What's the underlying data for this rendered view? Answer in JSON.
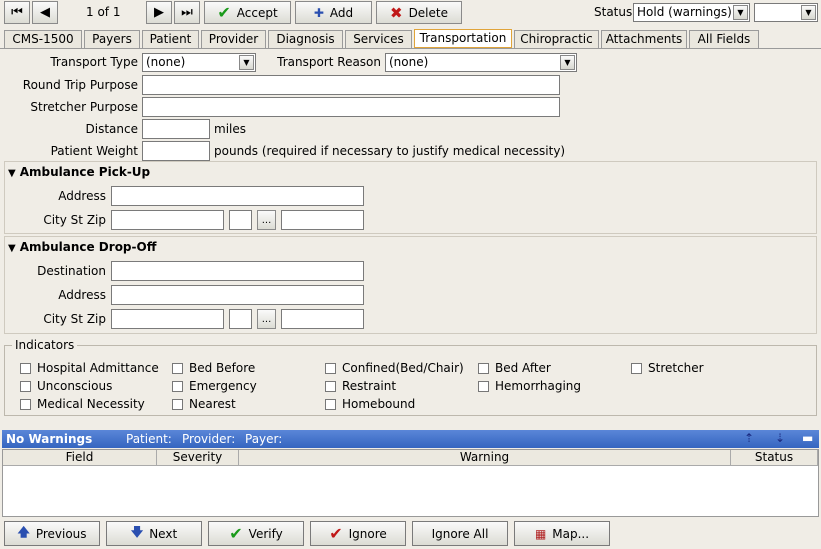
{
  "toolbar": {
    "record_position": "1 of 1",
    "accept_label": "Accept",
    "add_label": "Add",
    "delete_label": "Delete",
    "status_label": "Status",
    "status_value": "Hold (warnings)",
    "status_secondary_value": ""
  },
  "tabs": [
    "CMS-1500",
    "Payers",
    "Patient",
    "Provider",
    "Diagnosis",
    "Services",
    "Transportation",
    "Chiropractic",
    "Attachments",
    "All Fields"
  ],
  "active_tab": "Transportation",
  "transport": {
    "transport_type_label": "Transport Type",
    "transport_type_value": "(none)",
    "transport_reason_label": "Transport Reason",
    "transport_reason_value": "(none)",
    "round_trip_label": "Round Trip Purpose",
    "stretcher_label": "Stretcher Purpose",
    "distance_label": "Distance",
    "distance_unit": "miles",
    "weight_label": "Patient Weight",
    "weight_unit": "pounds (required if necessary to justify medical necessity)"
  },
  "pickup": {
    "title": "Ambulance Pick-Up",
    "address_label": "Address",
    "city_label": "City St Zip",
    "ellipsis": "..."
  },
  "dropoff": {
    "title": "Ambulance Drop-Off",
    "destination_label": "Destination",
    "address_label": "Address",
    "city_label": "City St Zip",
    "ellipsis": "..."
  },
  "indicators": {
    "title": "Indicators",
    "items": [
      "Hospital Admittance",
      "Unconscious",
      "Medical Necessity",
      "Bed Before",
      "Emergency",
      "Nearest",
      "Confined(Bed/Chair)",
      "Restraint",
      "Homebound",
      "Bed After",
      "Hemorrhaging",
      "Stretcher"
    ]
  },
  "warnings": {
    "title": "No Warnings",
    "patient": "Patient:",
    "provider": "Provider:",
    "payer": "Payer:",
    "columns": [
      "Field",
      "Severity",
      "Warning",
      "Status"
    ]
  },
  "bottom": {
    "previous": "Previous",
    "next": "Next",
    "verify": "Verify",
    "ignore": "Ignore",
    "ignore_all": "Ignore All",
    "map": "Map..."
  }
}
